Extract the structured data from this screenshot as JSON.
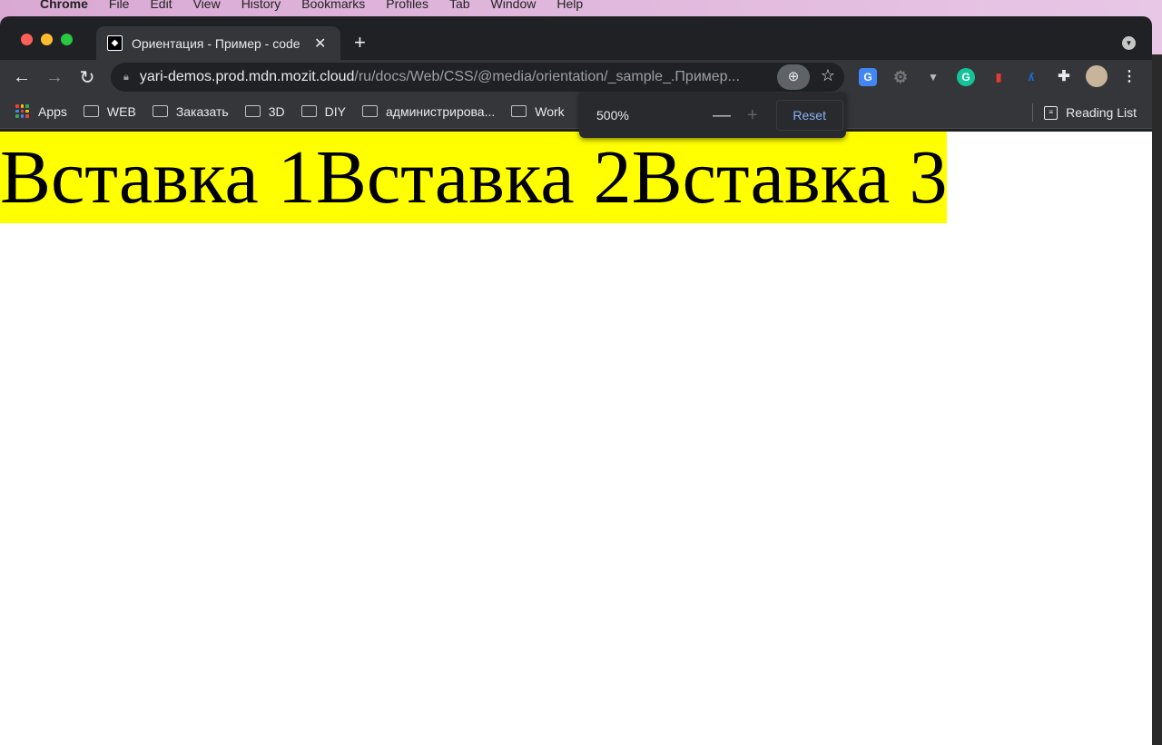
{
  "menubar": {
    "app": "Chrome",
    "items": [
      "File",
      "Edit",
      "View",
      "History",
      "Bookmarks",
      "Profiles",
      "Tab",
      "Window",
      "Help"
    ]
  },
  "tab": {
    "title": "Ориентация - Пример - code"
  },
  "address": {
    "host": "yari-demos.prod.mdn.mozit.cloud",
    "path": "/ru/docs/Web/CSS/@media/orientation/_sample_.Пример..."
  },
  "bookmarks": {
    "items": [
      "Apps",
      "WEB",
      "Заказать",
      "3D",
      "DIY",
      "администрирова...",
      "Work"
    ],
    "reading_list": "Reading List"
  },
  "zoom": {
    "level": "500%",
    "reset": "Reset"
  },
  "page": {
    "text": "Вставка 1Вставка 2Вставка 3"
  },
  "colors": {
    "banner": "#ffff00",
    "link": "#8ab4f8"
  }
}
